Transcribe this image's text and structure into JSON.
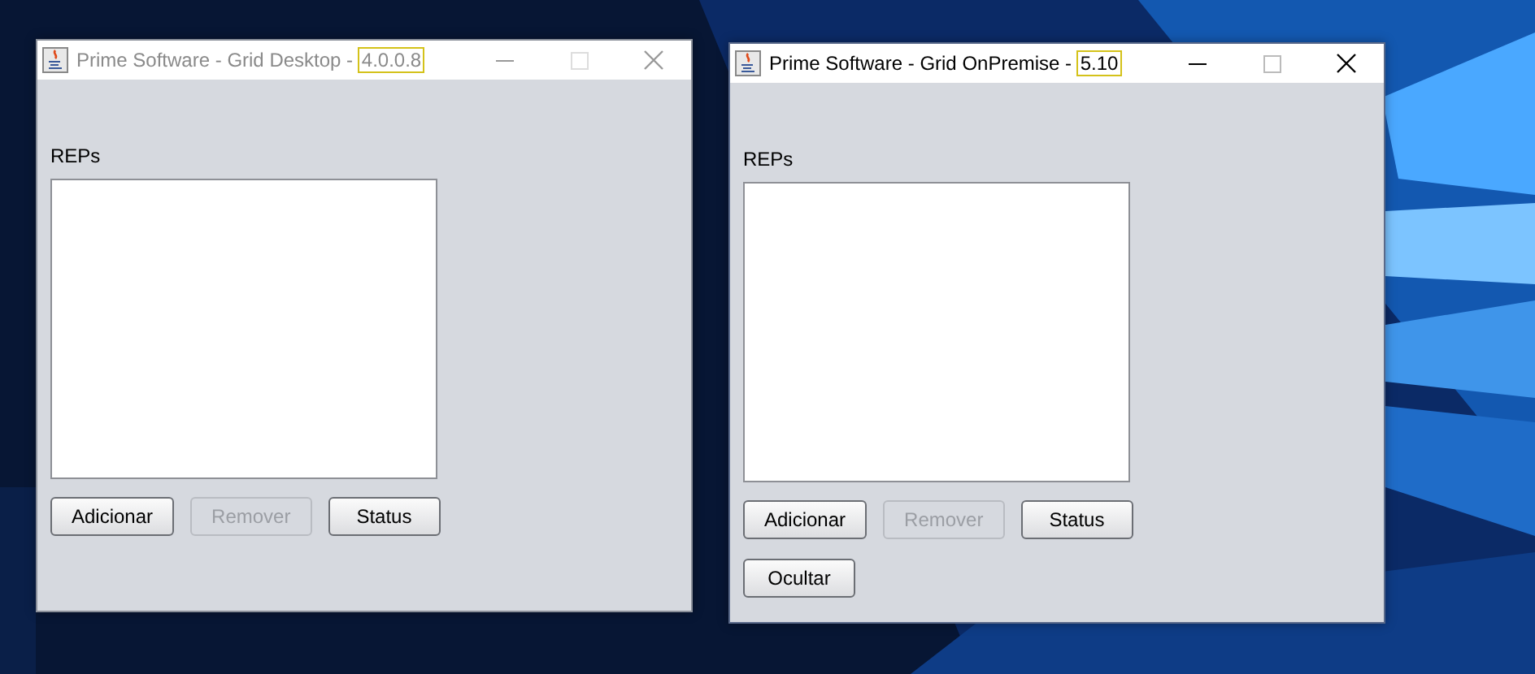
{
  "windows": [
    {
      "title": "Prime Software - Grid Desktop - ",
      "version": "4.0.0.8",
      "active": false,
      "list_label": "REPs",
      "buttons": [
        {
          "label": "Adicionar",
          "disabled": false
        },
        {
          "label": "Remover",
          "disabled": true
        },
        {
          "label": "Status",
          "disabled": false
        }
      ]
    },
    {
      "title": "Prime Software - Grid OnPremise - ",
      "version": "5.10",
      "active": true,
      "list_label": "REPs",
      "buttons": [
        {
          "label": "Adicionar",
          "disabled": false
        },
        {
          "label": "Remover",
          "disabled": true
        },
        {
          "label": "Status",
          "disabled": false
        },
        {
          "label": "Ocultar",
          "disabled": false
        }
      ]
    }
  ]
}
